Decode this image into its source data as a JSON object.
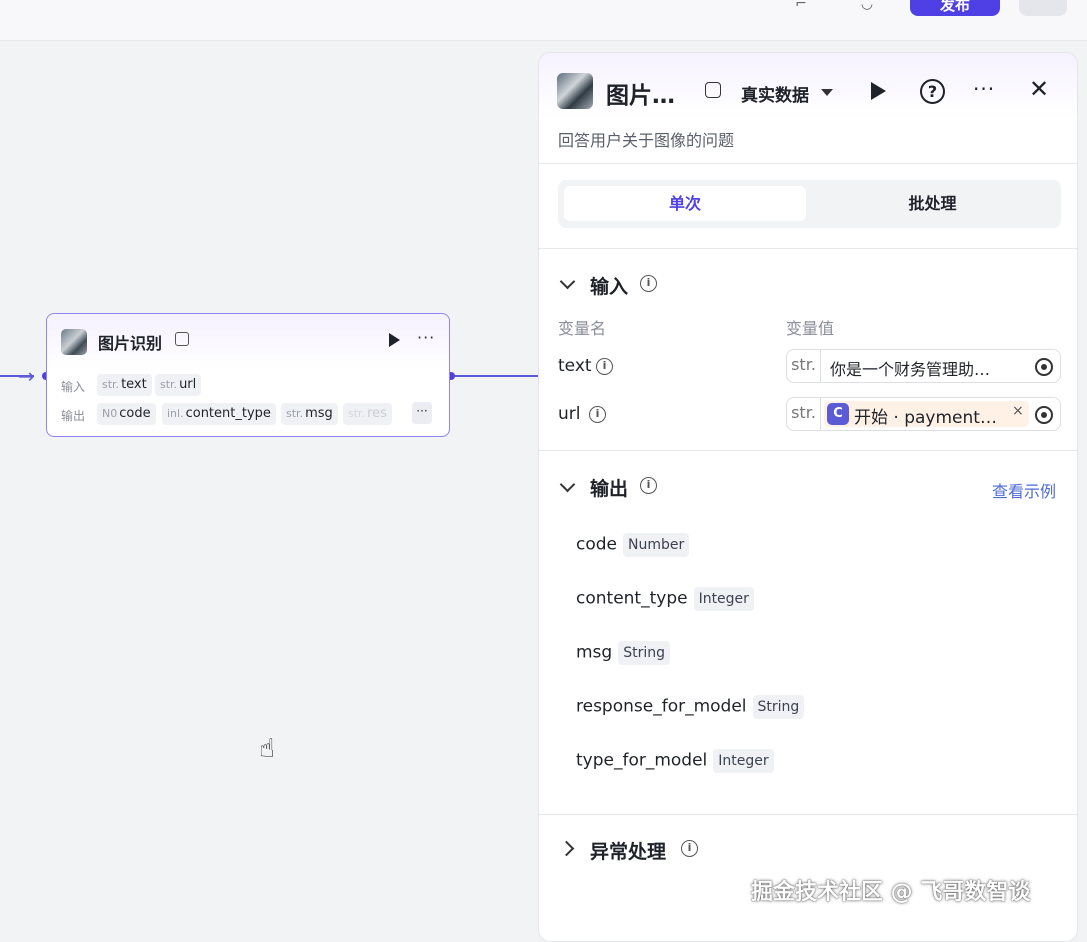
{
  "topbar": {
    "publish_label": "发布"
  },
  "node": {
    "title": "图片识别",
    "input_label": "输入",
    "output_label": "输出",
    "inputs": [
      {
        "type": "str.",
        "name": "text"
      },
      {
        "type": "str.",
        "name": "url"
      }
    ],
    "outputs": [
      {
        "type": "N0",
        "name": "code"
      },
      {
        "type": "inl.",
        "name": "content_type"
      },
      {
        "type": "str.",
        "name": "msg"
      },
      {
        "type": "str.",
        "name": "res"
      }
    ],
    "more_label": "···"
  },
  "panel": {
    "title": "图片…",
    "data_mode": "真实数据",
    "description": "回答用户关于图像的问题",
    "tabs": [
      "单次",
      "批处理"
    ],
    "input_section": {
      "title": "输入",
      "col_name": "变量名",
      "col_value": "变量值",
      "rows": [
        {
          "name": "text",
          "type": "str.",
          "value": "你是一个财务管理助…"
        },
        {
          "name": "url",
          "type": "str.",
          "value_var": "开始 · payment…",
          "var_icon": "C"
        }
      ]
    },
    "output_section": {
      "title": "输出",
      "link": "查看示例",
      "rows": [
        {
          "name": "code",
          "type": "Number"
        },
        {
          "name": "content_type",
          "type": "Integer"
        },
        {
          "name": "msg",
          "type": "String"
        },
        {
          "name": "response_for_model",
          "type": "String"
        },
        {
          "name": "type_for_model",
          "type": "Integer"
        }
      ]
    },
    "error_section": {
      "title": "异常处理"
    }
  },
  "watermark": "掘金技术社区 @ 飞哥数智谈",
  "icons": {
    "cursor": "hand-grab-icon",
    "run": "play-icon",
    "help": "question-icon",
    "close": "close-icon",
    "more": "more-icon",
    "info": "info-icon"
  },
  "colors": {
    "accent": "#4e40e5",
    "edge": "#5b5bd6",
    "link": "#4e6bd8",
    "canvas": "#f2f3f5"
  }
}
